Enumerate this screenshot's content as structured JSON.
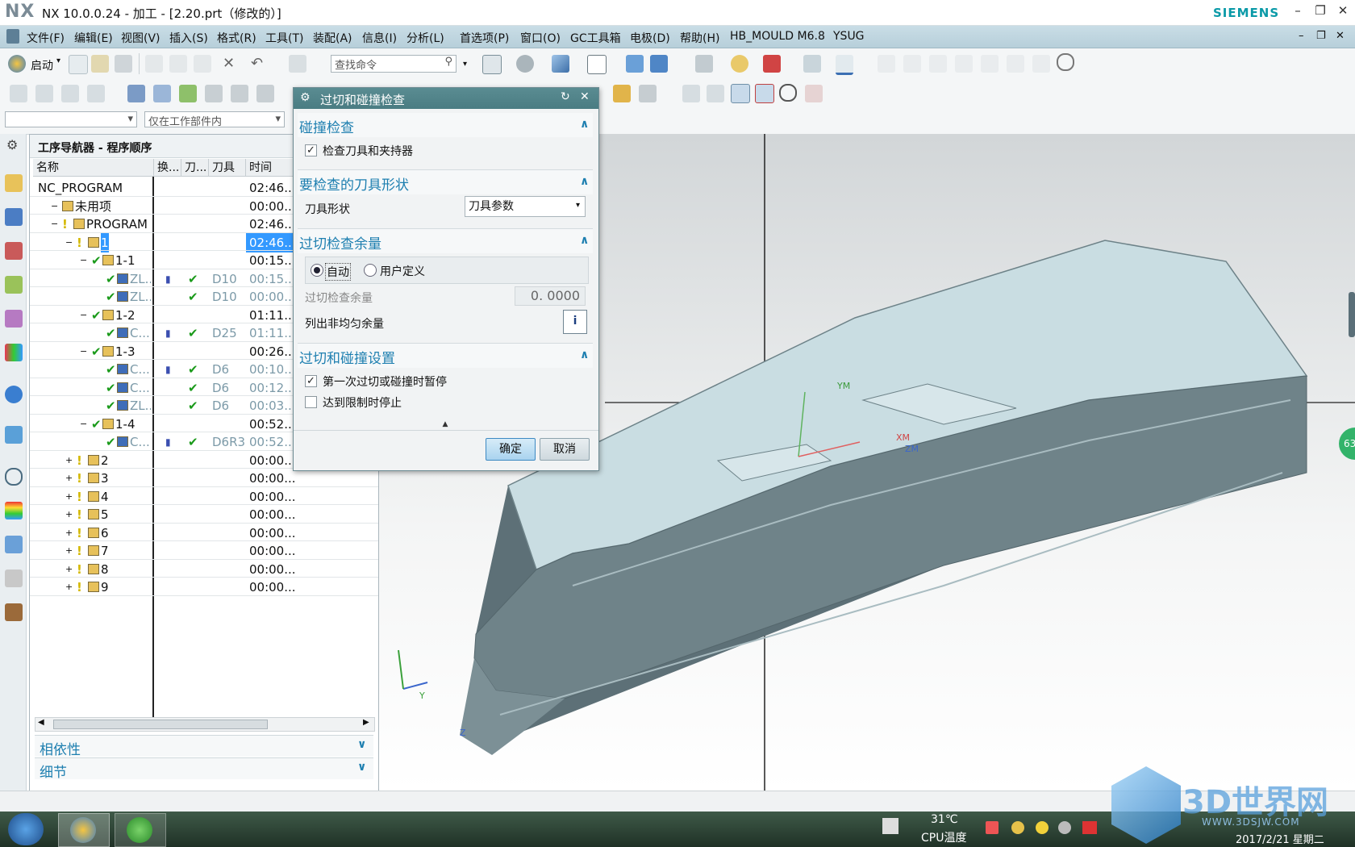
{
  "window": {
    "logo": "NX",
    "title": "NX 10.0.0.24 - 加工 - [2.20.prt（修改的）]",
    "brand": "SIEMENS"
  },
  "menubar": [
    "文件(F)",
    "编辑(E)",
    "视图(V)",
    "插入(S)",
    "格式(R)",
    "工具(T)",
    "装配(A)",
    "信息(I)",
    "分析(L)",
    "首选项(P)",
    "窗口(O)",
    "GC工具箱",
    "电极(D)",
    "帮助(H)",
    "HB_MOULD M6.8",
    "YSUG"
  ],
  "toolbar": {
    "start_label": "启动",
    "search_placeholder": "查找命令",
    "filter_placeholder": "仅在工作部件内"
  },
  "navigator": {
    "title": "工序导航器 - 程序顺序",
    "columns": [
      "名称",
      "换...",
      "刀...",
      "刀具",
      "时间"
    ],
    "rows": [
      {
        "name": "NC_PROGRAM",
        "time": "02:46...",
        "tool": "",
        "indent": 0
      },
      {
        "name": "未用项",
        "time": "00:00...",
        "tool": "",
        "indent": 1
      },
      {
        "name": "PROGRAM",
        "time": "02:46...",
        "tool": "",
        "indent": 1
      },
      {
        "name": "1",
        "time": "02:46...",
        "tool": "",
        "indent": 2
      },
      {
        "name": "1-1",
        "time": "00:15...",
        "tool": "",
        "indent": 3
      },
      {
        "name": "ZL...",
        "time": "00:15...",
        "tool": "D10",
        "indent": 4
      },
      {
        "name": "ZL...",
        "time": "00:00...",
        "tool": "D10",
        "indent": 4
      },
      {
        "name": "1-2",
        "time": "01:11...",
        "tool": "",
        "indent": 3
      },
      {
        "name": "C...",
        "time": "01:11...",
        "tool": "D25",
        "indent": 4
      },
      {
        "name": "1-3",
        "time": "00:26...",
        "tool": "",
        "indent": 3
      },
      {
        "name": "C...",
        "time": "00:10...",
        "tool": "D6",
        "indent": 4
      },
      {
        "name": "C...",
        "time": "00:12...",
        "tool": "D6",
        "indent": 4
      },
      {
        "name": "ZL...",
        "time": "00:03...",
        "tool": "D6",
        "indent": 4
      },
      {
        "name": "1-4",
        "time": "00:52...",
        "tool": "",
        "indent": 3
      },
      {
        "name": "C...",
        "time": "00:52...",
        "tool": "D6R3",
        "indent": 4
      },
      {
        "name": "2",
        "time": "00:00...",
        "tool": "",
        "indent": 2
      },
      {
        "name": "3",
        "time": "00:00...",
        "tool": "",
        "indent": 2
      },
      {
        "name": "4",
        "time": "00:00...",
        "tool": "",
        "indent": 2
      },
      {
        "name": "5",
        "time": "00:00...",
        "tool": "",
        "indent": 2
      },
      {
        "name": "6",
        "time": "00:00...",
        "tool": "",
        "indent": 2
      },
      {
        "name": "7",
        "time": "00:00...",
        "tool": "",
        "indent": 2
      },
      {
        "name": "8",
        "time": "00:00...",
        "tool": "",
        "indent": 2
      },
      {
        "name": "9",
        "time": "00:00...",
        "tool": "",
        "indent": 2
      }
    ],
    "panel_dependencies": "相依性",
    "panel_details": "细节"
  },
  "dialog": {
    "title": "过切和碰撞检查",
    "group1_title": "碰撞检查",
    "chk_tool_holder": "检查刀具和夹持器",
    "group2_title": "要检查的刀具形状",
    "tool_shape_label": "刀具形状",
    "tool_shape_value": "刀具参数",
    "group3_title": "过切检查余量",
    "radio_auto": "自动",
    "radio_user": "用户定义",
    "stock_label": "过切检查余量",
    "stock_value": "0. 0000",
    "list_nonuniform": "列出非均匀余量",
    "group4_title": "过切和碰撞设置",
    "chk_pause": "第一次过切或碰撞时暂停",
    "chk_stop": "达到限制时停止",
    "ok": "确定",
    "cancel": "取消"
  },
  "graphics": {
    "axis_ym": "YM",
    "axis_xm": "XM",
    "axis_zm": "ZM",
    "triad_y": "Y",
    "triad_z": "Z",
    "badge": "63"
  },
  "taskbar": {
    "temp": "31℃",
    "temp_label": "CPU温度",
    "date": "2017/2/21 星期二",
    "watermark": "3D世界网",
    "watermark_url": "WWW.3DSJW.COM"
  }
}
